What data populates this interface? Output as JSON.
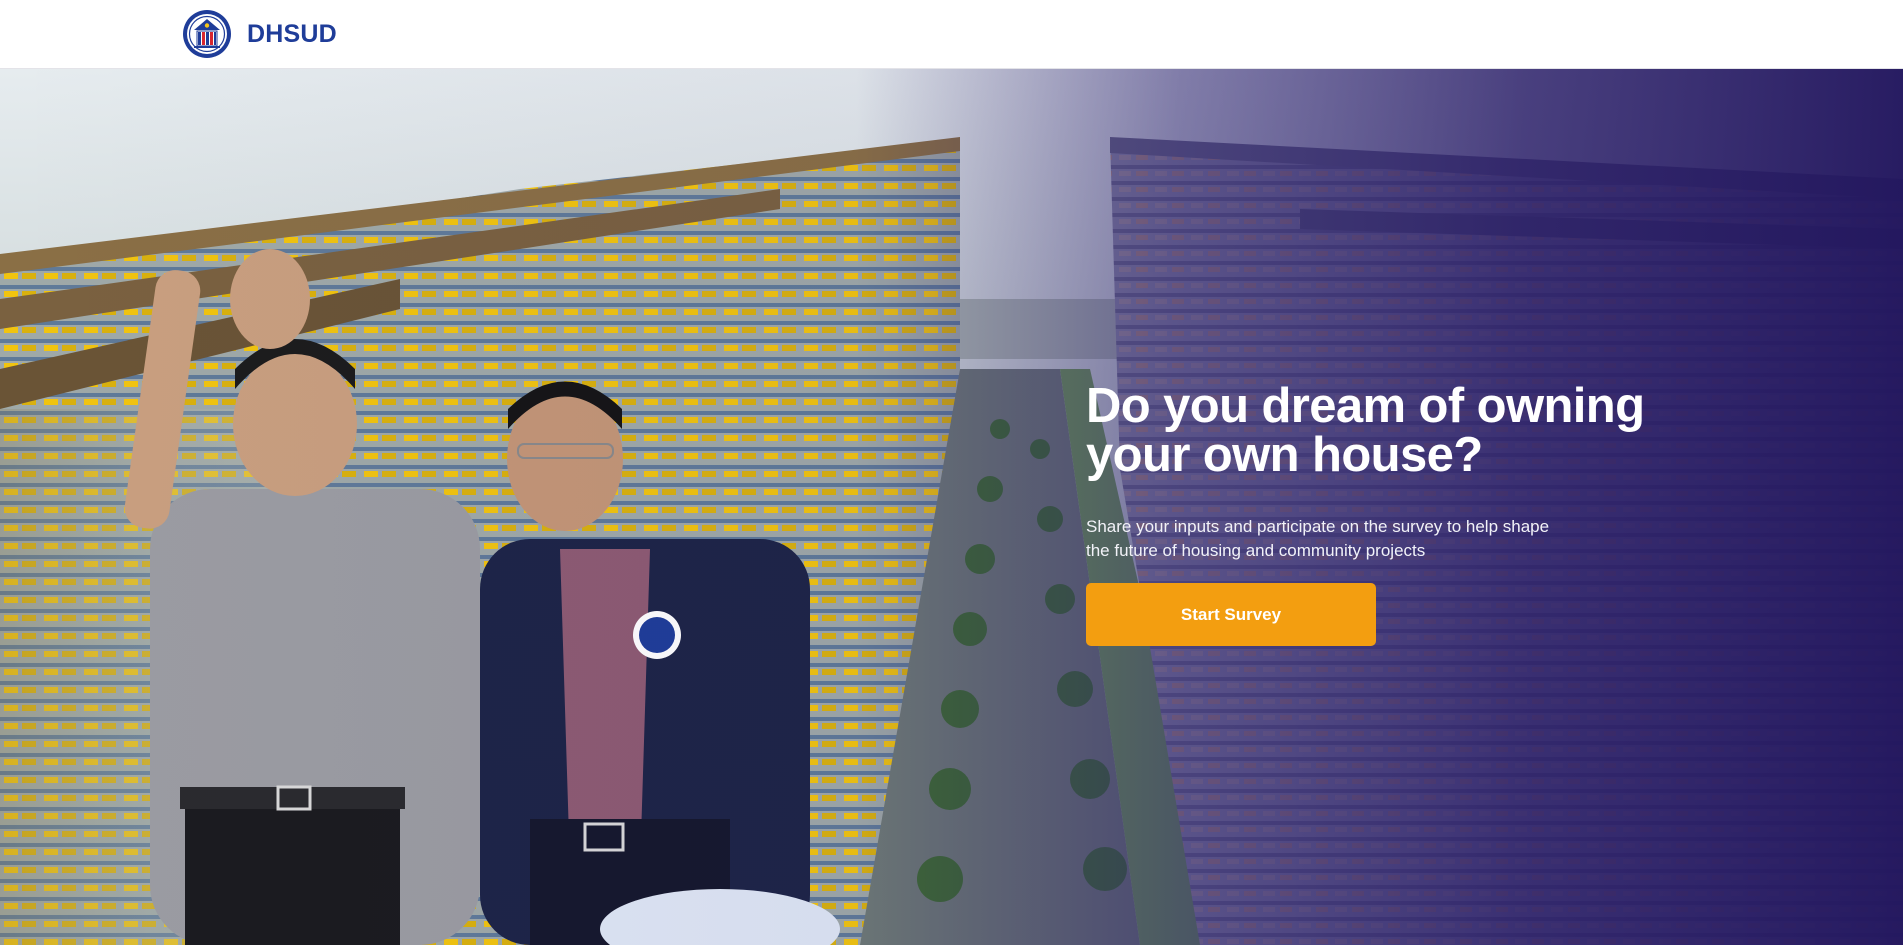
{
  "header": {
    "brand_name": "DHSUD",
    "logo_icon": "government-seal-icon"
  },
  "hero": {
    "headline_line1": "Do you dream of owning",
    "headline_line2": "your own house?",
    "subtext_line1": "Share your inputs and participate on the survey to help shape",
    "subtext_line2": "the future of housing and community projects",
    "cta_label": "Start Survey",
    "photo": "aerial-rendering-of-housing-towers-with-two-officials"
  },
  "colors": {
    "brand_blue": "#1f3d99",
    "overlay_purple": "#271a66",
    "cta_orange": "#f39e10",
    "text_white": "#ffffff"
  }
}
